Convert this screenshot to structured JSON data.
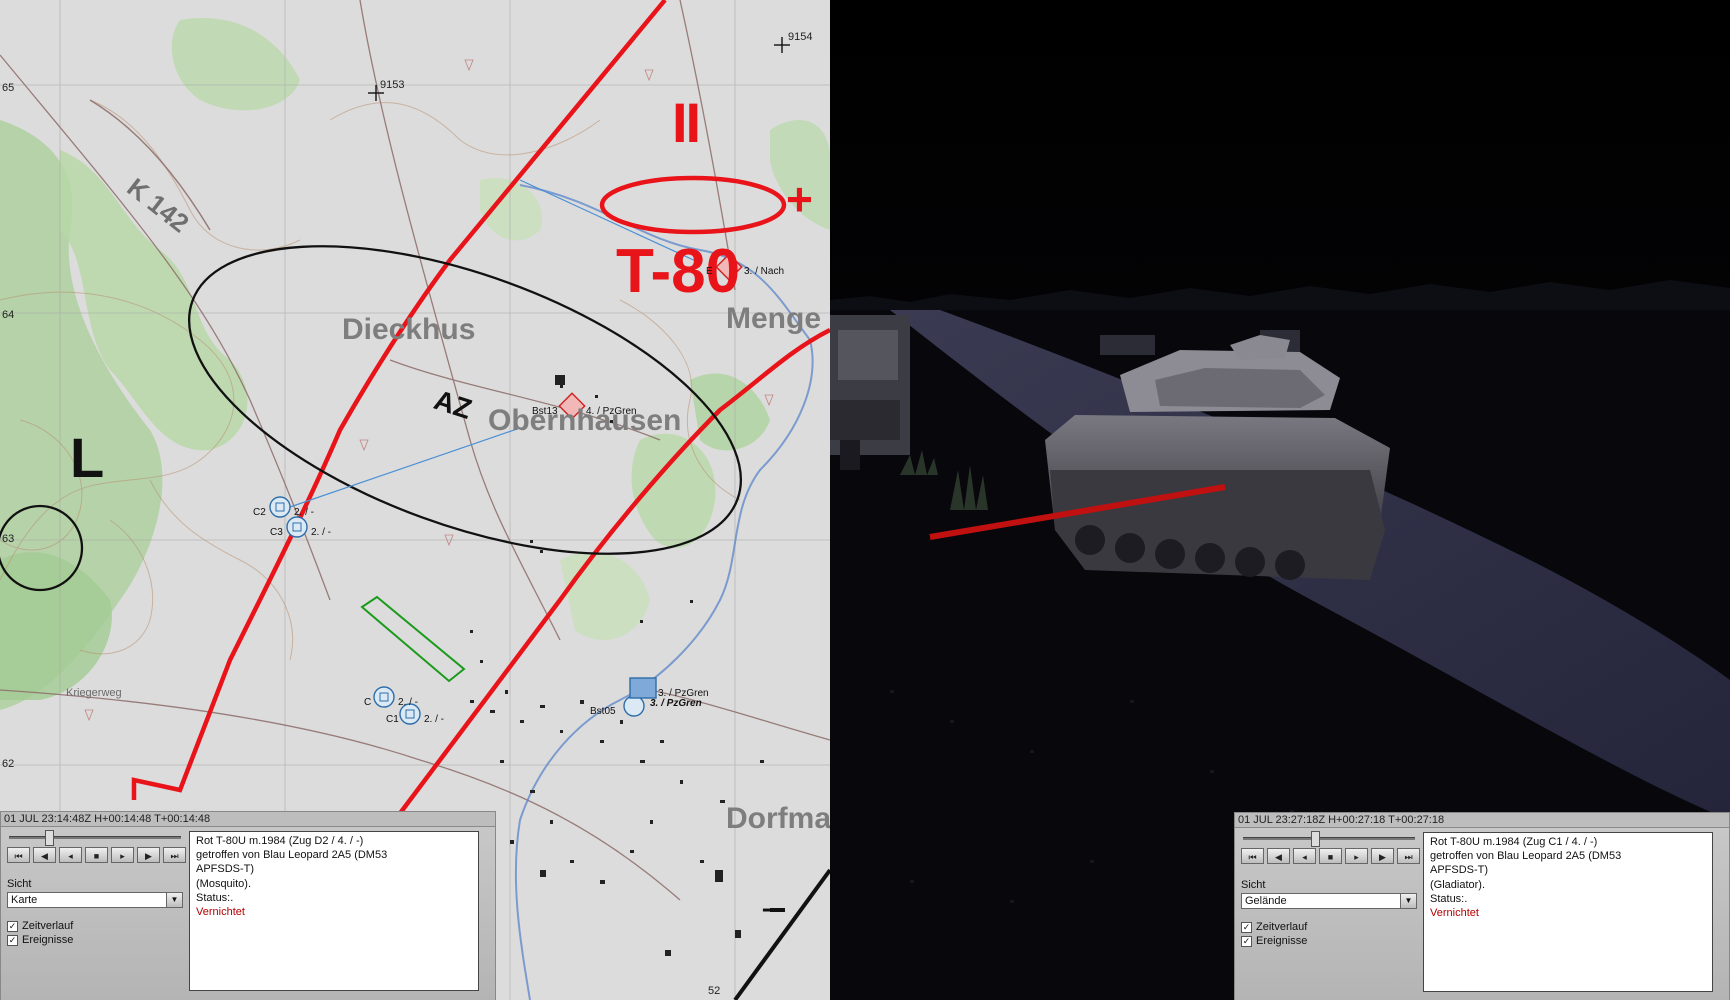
{
  "map": {
    "grid_numbers": [
      "65",
      "64",
      "63",
      "62",
      "9153",
      "9154",
      "52"
    ],
    "place_names": {
      "dieckhus": "Dieckhus",
      "obernhausen": "Obernhausen",
      "menge": "Menge",
      "dorfma": "Dorfma",
      "kriegerweg": "Kriegerweg",
      "road_k142": "K 142"
    },
    "tactical_labels": {
      "brigade": "II",
      "plus": "+",
      "enemy_type": "T-80",
      "sector_l": "L",
      "az": "AZ",
      "minus": "–"
    },
    "unit_labels": {
      "c2": "C2",
      "c3": "C3",
      "c2_side": "2. / -",
      "c3_side": "2. / -",
      "c": "C",
      "c1": "C1",
      "c_side": "2. / -",
      "c1_side": "2. / -",
      "bst13": "Bst13",
      "pzgren4": "4. / PzGren",
      "pzgren3a": "3. / PzGren",
      "pzgren3b": "3. / PzGren",
      "bst05": "Bst05",
      "nach": "3. / Nach",
      "e": "E"
    },
    "colors": {
      "phase_line": "#e8141a",
      "ellipse": "#111111",
      "friendly": "#4a90d6",
      "enemy": "#e0303a"
    }
  },
  "panel_left": {
    "time_bar": "01 JUL 23:14:48Z  H+00:14:48  T+00:14:48",
    "controls": [
      "⏮",
      "◀",
      "◂",
      "■",
      "▸",
      "▶",
      "⏭"
    ],
    "view_label": "Sicht",
    "view_value": "Karte",
    "checkbox_timeline": "Zeitverlauf",
    "checkbox_events": "Ereignisse",
    "info_lines": [
      "Rot T-80U m.1984 (Zug D2 / 4. / -)",
      "getroffen von Blau Leopard 2A5 (DM53",
      "APFSDS-T)",
      "(Mosquito).",
      "Status:."
    ],
    "status": "Vernichtet"
  },
  "panel_right": {
    "time_bar": "01 JUL 23:27:18Z  H+00:27:18  T+00:27:18",
    "controls": [
      "⏮",
      "◀",
      "◂",
      "■",
      "▸",
      "▶",
      "⏭"
    ],
    "view_label": "Sicht",
    "view_value": "Gelände",
    "checkbox_timeline": "Zeitverlauf",
    "checkbox_events": "Ereignisse",
    "info_lines": [
      "Rot T-80U m.1984 (Zug C1 / 4. / -)",
      "getroffen von Blau Leopard 2A5 (DM53",
      "APFSDS-T)",
      "(Gladiator).",
      "Status:."
    ],
    "status": "Vernichtet"
  }
}
